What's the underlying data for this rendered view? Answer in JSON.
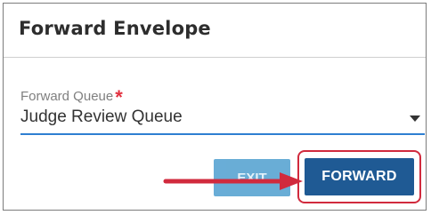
{
  "dialog": {
    "title": "Forward Envelope",
    "field": {
      "label": "Forward Queue",
      "required_marker": "*",
      "value": "Judge Review Queue"
    },
    "buttons": {
      "exit_label": "EXIT",
      "forward_label": "FORWARD"
    }
  },
  "annotation": {
    "arrow_color": "#d12a3d",
    "highlight_color": "#d12a3d"
  },
  "colors": {
    "forward_button": "#1f5a94",
    "exit_button": "#4f9fd0",
    "select_underline": "#2e7fd1",
    "required_star": "#e2313f"
  }
}
